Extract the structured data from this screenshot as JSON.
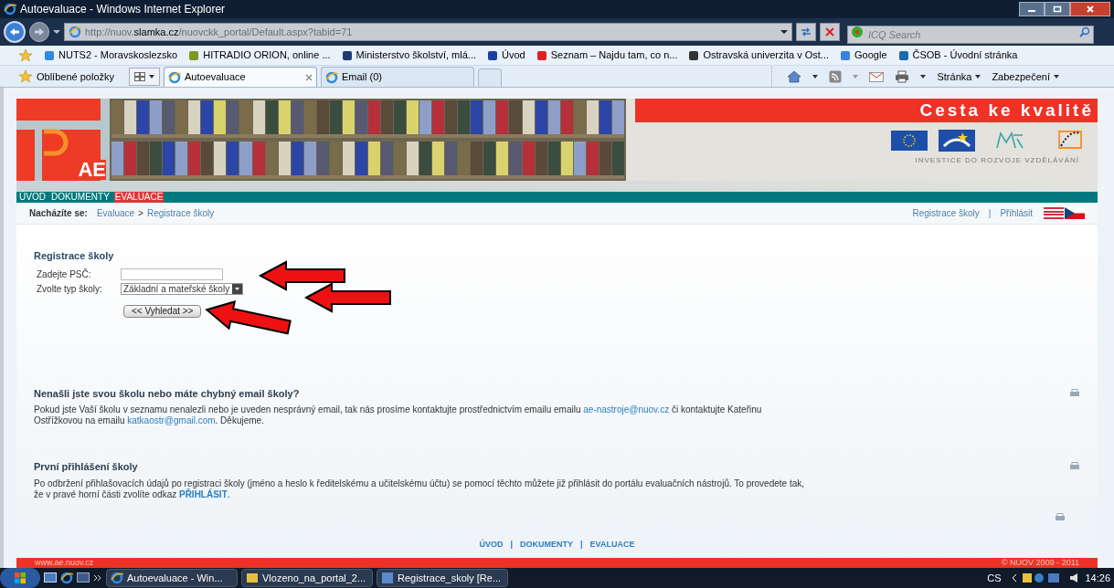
{
  "browser": {
    "title": "Autoevaluace - Windows Internet Explorer",
    "url_parts": [
      {
        "text": "http://nuov.",
        "strong": false
      },
      {
        "text": "slamka.cz",
        "strong": true
      },
      {
        "text": "/nuovckk_portal/Default.aspx?tabid=71",
        "strong": false
      }
    ],
    "search_placeholder": "ICQ Search",
    "favorites": [
      "NUTS2 - Moravskoslezsko",
      "HITRADIO ORION, online ...",
      "Ministerstvo školství, mlá...",
      "Úvod",
      "Seznam – Najdu tam, co n...",
      "Ostravská univerzita v Ost...",
      "Google",
      "ČSOB - Úvodní stránka"
    ],
    "favorites_label": "Oblíbené položky",
    "tabs": [
      {
        "label": "Autoevaluace",
        "selected": true
      },
      {
        "label": "Email (0)",
        "selected": false
      }
    ],
    "commands": [
      "Stránka",
      "Zabezpečení"
    ]
  },
  "page": {
    "logo_text": "AE",
    "slogan": "Cesta ke kvalitě",
    "sponsor_caption": "INVESTICE DO ROZVOJE VZDĚLÁVÁNÍ",
    "nav": [
      {
        "label": "ÚVOD",
        "selected": false
      },
      {
        "label": "DOKUMENTY",
        "selected": false
      },
      {
        "label": "EVALUACE",
        "selected": true
      }
    ],
    "breadcrumb": {
      "label": "Nacházíte se:",
      "items": [
        "Evaluace",
        "Registrace školy"
      ],
      "separator": ">"
    },
    "top_links": [
      "Registrace školy",
      "Přihlásit"
    ],
    "top_link_separator": "|",
    "form": {
      "title": "Registrace školy",
      "fields": [
        {
          "kind": "text",
          "label": "Zadejte PSČ:"
        },
        {
          "kind": "select",
          "label": "Zvolte typ školy:",
          "value": "Základní a mateřské školy"
        }
      ],
      "button": "<< Vyhledat >>"
    },
    "sections": [
      {
        "title": "Nenašli jste svou školu nebo máte chybný email školy?",
        "parts": [
          {
            "text": "Pokud jste Vaší školu v seznamu nenalezli nebo je uveden nesprávný email, tak nás prosíme kontaktujte prostřednictvím emailu emailu ",
            "link": false
          },
          {
            "text": "ae-nastroje@nuov.cz",
            "link": true
          },
          {
            "text": " či kontaktujte Kateřinu Ostřížkovou na emailu ",
            "link": false
          },
          {
            "text": "katkaostr@gmail.com",
            "link": true
          },
          {
            "text": ". Děkujeme.",
            "link": false
          }
        ]
      },
      {
        "title": "První přihlášení školy",
        "parts": [
          {
            "text": "Po odbržení přihlašovacích údajů po registraci školy (jméno a heslo k ředitelskému a učitelskému účtu) se pomocí těchto můžete již přihlásit do portálu evaluačních nástrojů. To provedete tak, že v pravé horní části zvolíte odkaz ",
            "link": false
          },
          {
            "text": "PŘIHLÁSIT",
            "link": true
          },
          {
            "text": ".",
            "link": false
          }
        ]
      }
    ],
    "footer_links": [
      "ÚVOD",
      "DOKUMENTY",
      "EVALUACE"
    ],
    "footer_separator": "|",
    "footer_url": "www.ae.nuov.cz",
    "copyright": "© NUOV 2009 - 2011"
  },
  "taskbar": {
    "items": [
      "Autoevaluace - Win...",
      "Vlozeno_na_portal_2...",
      "Registrace_skoly [Re..."
    ],
    "language": "CS",
    "time": "14:26"
  }
}
